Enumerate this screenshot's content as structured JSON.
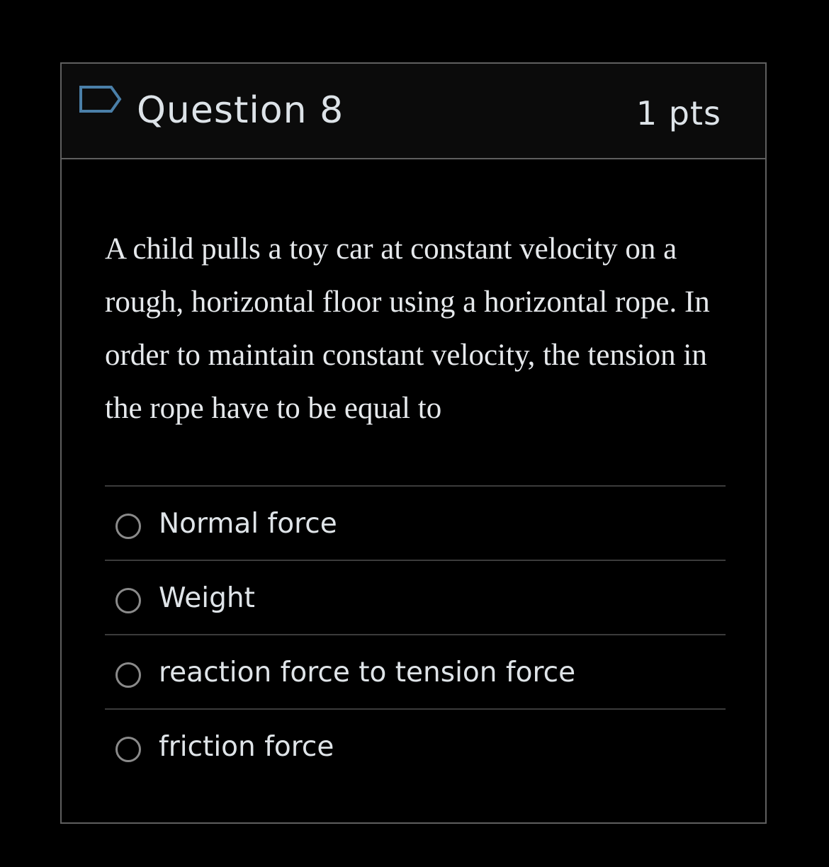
{
  "question": {
    "flag_icon": "flag-outline-icon",
    "title": "Question 8",
    "points": "1 pts",
    "text": "A child pulls a toy car at constant velocity on a rough, horizontal floor using a horizontal rope. In order to maintain constant velocity, the tension in the rope have to be equal to"
  },
  "answers": [
    {
      "label": "Normal force",
      "selected": false
    },
    {
      "label": "Weight",
      "selected": false
    },
    {
      "label": "reaction force to tension force",
      "selected": false
    },
    {
      "label": "friction force",
      "selected": false
    }
  ],
  "colors": {
    "background": "#000000",
    "header_background": "#0b0b0b",
    "border": "#5f5f5f",
    "flag_accent": "#4a7fa8",
    "text": "#e6e9ec",
    "radio_border": "#8a8a8a"
  }
}
